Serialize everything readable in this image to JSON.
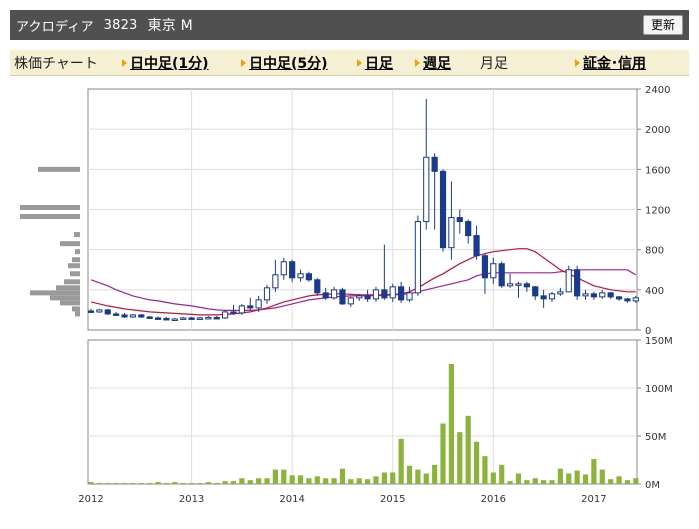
{
  "header": {
    "company_name": "アクロディア",
    "code": "3823",
    "market": "東京 M",
    "refresh_label": "更新"
  },
  "nav": {
    "section_label": "株価チャート",
    "links": [
      "日中足(1分)",
      "日中足(5分)",
      "日足",
      "週足"
    ],
    "current": "月足",
    "margin_link": "証金･信用"
  },
  "colors": {
    "title_bar": "#505050",
    "nav_bg": "#f5f0d4",
    "arrow": "#f0a000",
    "candle_up": "#1a3a8c",
    "ma_short": "#c0143c",
    "ma_long": "#a020a0",
    "volume_bar": "#8cb43c",
    "price_profile": "#9a9a9a"
  },
  "chart_data": [
    {
      "type": "candlestick",
      "yticks": [
        "2400",
        "2000",
        "1600",
        "1200",
        "800",
        "400",
        "0"
      ],
      "ylim": [
        0,
        2400
      ],
      "xticks": [
        "2012",
        "2013",
        "2014",
        "2015",
        "2016",
        "2017"
      ],
      "grid": true,
      "candles": [
        {
          "o": 190,
          "h": 210,
          "l": 170,
          "c": 180
        },
        {
          "o": 180,
          "h": 210,
          "l": 170,
          "c": 200
        },
        {
          "o": 200,
          "h": 210,
          "l": 150,
          "c": 160
        },
        {
          "o": 160,
          "h": 180,
          "l": 140,
          "c": 150
        },
        {
          "o": 150,
          "h": 170,
          "l": 120,
          "c": 130
        },
        {
          "o": 130,
          "h": 160,
          "l": 120,
          "c": 150
        },
        {
          "o": 150,
          "h": 160,
          "l": 120,
          "c": 130
        },
        {
          "o": 130,
          "h": 140,
          "l": 110,
          "c": 120
        },
        {
          "o": 120,
          "h": 135,
          "l": 110,
          "c": 115
        },
        {
          "o": 115,
          "h": 130,
          "l": 100,
          "c": 105
        },
        {
          "o": 105,
          "h": 120,
          "l": 95,
          "c": 110
        },
        {
          "o": 110,
          "h": 130,
          "l": 100,
          "c": 120
        },
        {
          "o": 120,
          "h": 130,
          "l": 105,
          "c": 110
        },
        {
          "o": 110,
          "h": 130,
          "l": 100,
          "c": 120
        },
        {
          "o": 120,
          "h": 140,
          "l": 110,
          "c": 125
        },
        {
          "o": 125,
          "h": 140,
          "l": 110,
          "c": 120
        },
        {
          "o": 120,
          "h": 200,
          "l": 110,
          "c": 180
        },
        {
          "o": 180,
          "h": 250,
          "l": 150,
          "c": 170
        },
        {
          "o": 170,
          "h": 260,
          "l": 150,
          "c": 240
        },
        {
          "o": 240,
          "h": 320,
          "l": 200,
          "c": 220
        },
        {
          "o": 220,
          "h": 340,
          "l": 180,
          "c": 300
        },
        {
          "o": 300,
          "h": 450,
          "l": 260,
          "c": 420
        },
        {
          "o": 420,
          "h": 700,
          "l": 380,
          "c": 550
        },
        {
          "o": 550,
          "h": 720,
          "l": 500,
          "c": 680
        },
        {
          "o": 680,
          "h": 700,
          "l": 480,
          "c": 520
        },
        {
          "o": 520,
          "h": 600,
          "l": 480,
          "c": 560
        },
        {
          "o": 560,
          "h": 580,
          "l": 480,
          "c": 500
        },
        {
          "o": 500,
          "h": 520,
          "l": 340,
          "c": 370
        },
        {
          "o": 370,
          "h": 420,
          "l": 300,
          "c": 320
        },
        {
          "o": 320,
          "h": 430,
          "l": 300,
          "c": 400
        },
        {
          "o": 400,
          "h": 420,
          "l": 250,
          "c": 260
        },
        {
          "o": 260,
          "h": 330,
          "l": 230,
          "c": 320
        },
        {
          "o": 320,
          "h": 360,
          "l": 290,
          "c": 340
        },
        {
          "o": 340,
          "h": 400,
          "l": 280,
          "c": 310
        },
        {
          "o": 310,
          "h": 430,
          "l": 280,
          "c": 400
        },
        {
          "o": 400,
          "h": 850,
          "l": 300,
          "c": 320
        },
        {
          "o": 320,
          "h": 460,
          "l": 280,
          "c": 430
        },
        {
          "o": 430,
          "h": 480,
          "l": 270,
          "c": 300
        },
        {
          "o": 300,
          "h": 430,
          "l": 280,
          "c": 370
        },
        {
          "o": 370,
          "h": 1140,
          "l": 340,
          "c": 1080
        },
        {
          "o": 1080,
          "h": 2300,
          "l": 1000,
          "c": 1720
        },
        {
          "o": 1720,
          "h": 1760,
          "l": 1000,
          "c": 1580
        },
        {
          "o": 1580,
          "h": 1600,
          "l": 780,
          "c": 820
        },
        {
          "o": 820,
          "h": 1480,
          "l": 700,
          "c": 1120
        },
        {
          "o": 1120,
          "h": 1200,
          "l": 960,
          "c": 1080
        },
        {
          "o": 1080,
          "h": 1100,
          "l": 860,
          "c": 940
        },
        {
          "o": 940,
          "h": 1040,
          "l": 700,
          "c": 740
        },
        {
          "o": 740,
          "h": 760,
          "l": 360,
          "c": 520
        },
        {
          "o": 520,
          "h": 720,
          "l": 460,
          "c": 660
        },
        {
          "o": 660,
          "h": 680,
          "l": 420,
          "c": 440
        },
        {
          "o": 440,
          "h": 560,
          "l": 420,
          "c": 460
        },
        {
          "o": 460,
          "h": 480,
          "l": 320,
          "c": 460
        },
        {
          "o": 460,
          "h": 480,
          "l": 380,
          "c": 430
        },
        {
          "o": 430,
          "h": 440,
          "l": 300,
          "c": 340
        },
        {
          "o": 340,
          "h": 400,
          "l": 220,
          "c": 310
        },
        {
          "o": 310,
          "h": 380,
          "l": 280,
          "c": 360
        },
        {
          "o": 360,
          "h": 420,
          "l": 340,
          "c": 380
        },
        {
          "o": 380,
          "h": 640,
          "l": 380,
          "c": 600
        },
        {
          "o": 600,
          "h": 640,
          "l": 300,
          "c": 340
        },
        {
          "o": 340,
          "h": 400,
          "l": 300,
          "c": 360
        },
        {
          "o": 360,
          "h": 380,
          "l": 300,
          "c": 330
        },
        {
          "o": 330,
          "h": 400,
          "l": 310,
          "c": 370
        },
        {
          "o": 370,
          "h": 380,
          "l": 310,
          "c": 330
        },
        {
          "o": 330,
          "h": 340,
          "l": 290,
          "c": 310
        },
        {
          "o": 310,
          "h": 320,
          "l": 270,
          "c": 290
        },
        {
          "o": 290,
          "h": 340,
          "l": 270,
          "c": 320
        }
      ],
      "ma_short": [
        280,
        260,
        240,
        225,
        210,
        200,
        190,
        180,
        175,
        170,
        165,
        160,
        155,
        150,
        150,
        150,
        155,
        160,
        170,
        180,
        200,
        220,
        250,
        280,
        300,
        320,
        340,
        350,
        355,
        360,
        360,
        355,
        350,
        350,
        350,
        350,
        355,
        360,
        380,
        420,
        470,
        520,
        560,
        610,
        660,
        700,
        740,
        760,
        780,
        790,
        800,
        810,
        810,
        780,
        720,
        660,
        600,
        560,
        520,
        480,
        440,
        420,
        400,
        390,
        380,
        380
      ],
      "ma_long": [
        500,
        470,
        440,
        400,
        370,
        340,
        320,
        300,
        290,
        275,
        260,
        250,
        240,
        225,
        210,
        200,
        195,
        195,
        195,
        195,
        200,
        210,
        220,
        240,
        260,
        280,
        300,
        310,
        320,
        330,
        335,
        340,
        340,
        340,
        345,
        345,
        350,
        355,
        360,
        380,
        400,
        420,
        440,
        460,
        480,
        500,
        540,
        560,
        570,
        570,
        570,
        570,
        570,
        570,
        570,
        570,
        580,
        590,
        600,
        600,
        600,
        600,
        600,
        600,
        600,
        550
      ],
      "price_profile": [
        {
          "price": 1600,
          "len": 42
        },
        {
          "price": 1220,
          "len": 60
        },
        {
          "price": 1130,
          "len": 60
        },
        {
          "price": 950,
          "len": 6
        },
        {
          "price": 860,
          "len": 20
        },
        {
          "price": 780,
          "len": 5
        },
        {
          "price": 700,
          "len": 8
        },
        {
          "price": 640,
          "len": 12
        },
        {
          "price": 560,
          "len": 10
        },
        {
          "price": 480,
          "len": 16
        },
        {
          "price": 420,
          "len": 24
        },
        {
          "price": 370,
          "len": 50
        },
        {
          "price": 320,
          "len": 30
        },
        {
          "price": 270,
          "len": 20
        },
        {
          "price": 210,
          "len": 8
        },
        {
          "price": 160,
          "len": 5
        }
      ]
    },
    {
      "type": "bar",
      "yticks": [
        "150M",
        "100M",
        "50M",
        "0M"
      ],
      "ylim": [
        0,
        150
      ],
      "values": [
        2,
        1,
        1,
        1,
        1,
        1,
        1,
        1,
        2,
        1,
        2,
        1,
        1,
        1,
        2,
        1,
        3,
        3,
        6,
        4,
        6,
        6,
        15,
        15,
        9,
        9,
        6,
        8,
        6,
        6,
        16,
        5,
        6,
        5,
        8,
        12,
        12,
        47,
        19,
        15,
        11,
        20,
        63,
        125,
        54,
        71,
        44,
        29,
        12,
        20,
        3,
        11,
        4,
        6,
        4,
        4,
        16,
        11,
        14,
        10,
        26,
        15,
        5,
        8,
        4,
        6
      ]
    }
  ]
}
